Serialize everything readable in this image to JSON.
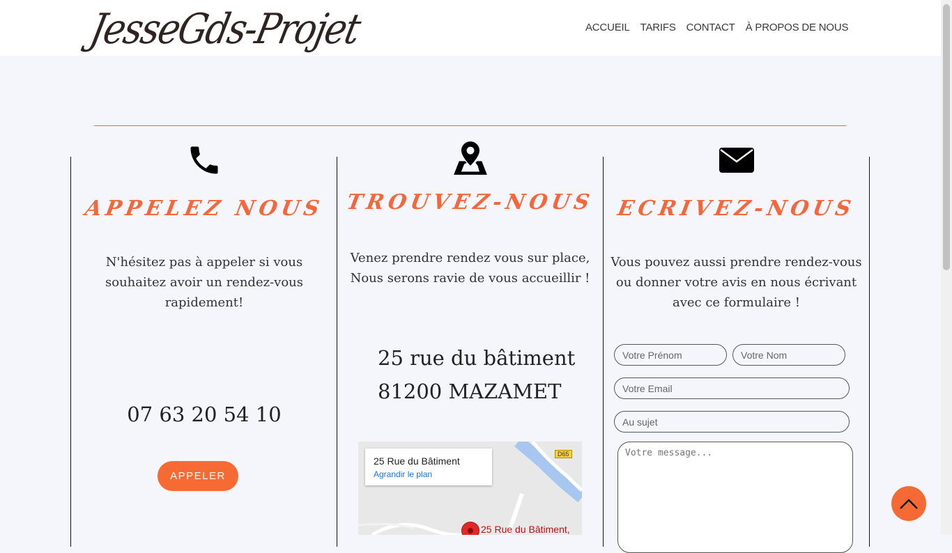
{
  "header": {
    "logo": "JesseGds-Projet",
    "nav": [
      "ACCUEIL",
      "TARIFS",
      "CONTACT",
      "À PROPOS DE NOUS"
    ]
  },
  "columns": {
    "call": {
      "icon": "phone-icon",
      "title": "APPELEZ  NOUS",
      "text_lines": [
        "N'hésitez pas à appeler si vous",
        "souhaitez avoir un rendez-vous",
        "rapidement!"
      ],
      "phone": "07 63 20 54 10",
      "button": "APPELER"
    },
    "find": {
      "icon": "map-pin-icon",
      "title": "TROUVEZ-NOUS",
      "text_lines": [
        "Venez prendre rendez vous sur place,",
        "Nous serons ravie de vous accueillir !"
      ],
      "address_lines": [
        "25 rue du bâtiment",
        "81200 MAZAMET"
      ],
      "map": {
        "card_title": "25 Rue du Bâtiment",
        "card_link": "Agrandir le plan",
        "road_badge": "D65",
        "pin_label": "25 Rue du Bâtiment,"
      }
    },
    "write": {
      "icon": "envelope-icon",
      "title": "ECRIVEZ-NOUS",
      "text_lines": [
        "Vous pouvez aussi prendre rendez-vous",
        "ou donner votre avis en nous écrivant",
        "avec ce formulaire !"
      ],
      "form": {
        "firstname_placeholder": "Votre Prénom",
        "lastname_placeholder": "Votre Nom",
        "email_placeholder": "Votre Email",
        "subject_placeholder": "Au sujet",
        "message_placeholder": "Votre message..."
      }
    }
  },
  "colors": {
    "accent": "#f76a33",
    "title": "#f2683c",
    "background": "#f5f6fc"
  },
  "scroll_top_icon": "chevron-up-icon"
}
